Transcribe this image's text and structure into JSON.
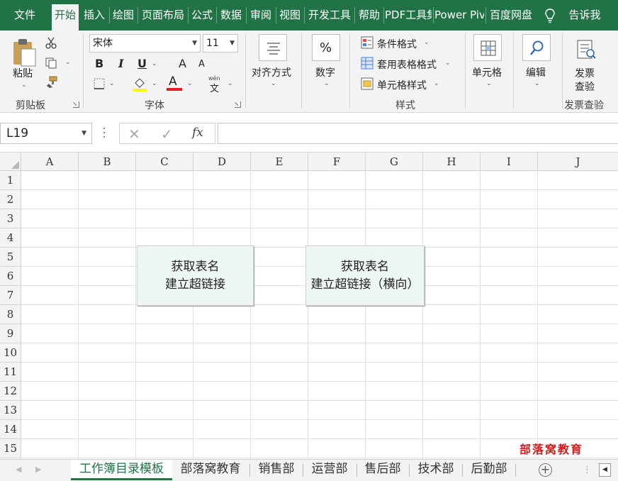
{
  "tabs": [
    {
      "label": "文件",
      "active": false
    },
    {
      "label": "开始",
      "active": true
    },
    {
      "label": "插入",
      "active": false
    },
    {
      "label": "绘图",
      "active": false
    },
    {
      "label": "页面布局",
      "active": false
    },
    {
      "label": "公式",
      "active": false
    },
    {
      "label": "数据",
      "active": false
    },
    {
      "label": "审阅",
      "active": false
    },
    {
      "label": "视图",
      "active": false
    },
    {
      "label": "开发工具",
      "active": false
    },
    {
      "label": "帮助",
      "active": false
    },
    {
      "label": "PDF工具集",
      "active": false
    },
    {
      "label": "Power Pivot",
      "active": false
    },
    {
      "label": "百度网盘",
      "active": false
    }
  ],
  "tell_me": "告诉我",
  "ribbon": {
    "clipboard": {
      "paste_label": "粘贴",
      "group_label": "剪贴板"
    },
    "font": {
      "font_name": "宋体",
      "font_size": "11",
      "group_label": "字体",
      "bold": "B",
      "italic": "I",
      "underline": "U",
      "grow": "A",
      "shrink": "A",
      "font_color_letter": "A",
      "phonetic_top": "wén",
      "phonetic_bottom": "文"
    },
    "alignment": {
      "label": "对齐方式"
    },
    "number": {
      "label": "数字",
      "icon_glyph": "%"
    },
    "styles": {
      "conditional": "条件格式",
      "table": "套用表格格式",
      "cell_style": "单元格样式",
      "group_label": "样式"
    },
    "cells": {
      "label": "单元格"
    },
    "editing": {
      "label": "编辑"
    },
    "invoice": {
      "label_line1": "发票",
      "label_line2": "查验",
      "group_label": "发票查验"
    }
  },
  "formula_bar": {
    "name_box": "L19",
    "fx": "fx",
    "formula": ""
  },
  "columns": [
    "A",
    "B",
    "C",
    "D",
    "E",
    "F",
    "G",
    "H",
    "I",
    "J"
  ],
  "rows": [
    "1",
    "2",
    "3",
    "4",
    "5",
    "6",
    "7",
    "8",
    "9",
    "10",
    "11",
    "12",
    "13",
    "14",
    "15"
  ],
  "buttons": [
    {
      "line1": "获取表名",
      "line2": "建立超链接"
    },
    {
      "line1": "获取表名",
      "line2": "建立超链接（横向）"
    }
  ],
  "watermark": "部落窝教育",
  "sheets": [
    {
      "label": "工作簿目录模板",
      "active": true
    },
    {
      "label": "部落窝教育",
      "active": false
    },
    {
      "label": "销售部",
      "active": false
    },
    {
      "label": "运营部",
      "active": false
    },
    {
      "label": "售后部",
      "active": false
    },
    {
      "label": "技术部",
      "active": false
    },
    {
      "label": "后勤部",
      "active": false
    }
  ],
  "colors": {
    "accent": "#217346",
    "button_fill": "#eef6f4",
    "watermark": "#d41b1b"
  }
}
